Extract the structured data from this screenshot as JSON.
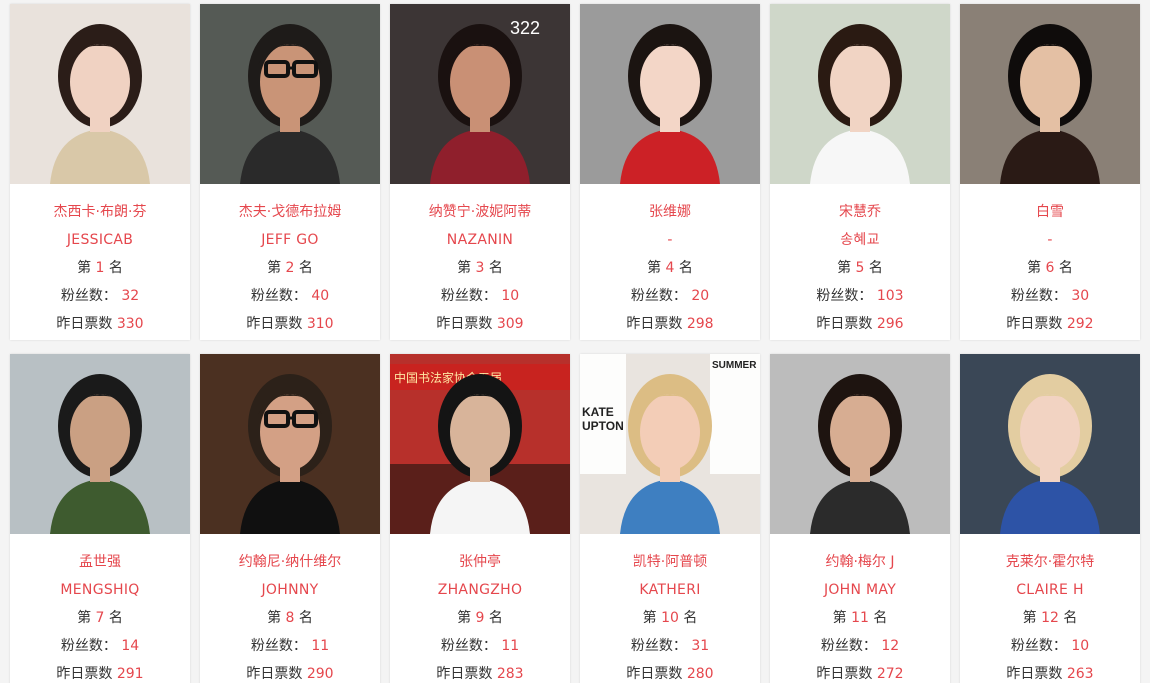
{
  "accent_color": "#e5474d",
  "labels": {
    "rank_prefix": "第",
    "rank_suffix": "名",
    "fans": "粉丝数：",
    "votes": "昨日票数"
  },
  "stars": [
    {
      "name_cn": "杰西卡·布朗·芬",
      "name_en": "JESSICAB",
      "rank": "1",
      "fans": "32",
      "votes": "330"
    },
    {
      "name_cn": "杰夫·戈德布拉姆",
      "name_en": "JEFF GO",
      "rank": "2",
      "fans": "40",
      "votes": "310"
    },
    {
      "name_cn": "纳赞宁·波妮阿蒂",
      "name_en": "NAZANIN",
      "rank": "3",
      "fans": "10",
      "votes": "309"
    },
    {
      "name_cn": "张维娜",
      "name_en": "-",
      "rank": "4",
      "fans": "20",
      "votes": "298"
    },
    {
      "name_cn": "宋慧乔",
      "name_en": "송혜교",
      "rank": "5",
      "fans": "103",
      "votes": "296"
    },
    {
      "name_cn": "白雪",
      "name_en": "-",
      "rank": "6",
      "fans": "30",
      "votes": "292"
    },
    {
      "name_cn": "孟世强",
      "name_en": "MENGSHIQ",
      "rank": "7",
      "fans": "14",
      "votes": "291"
    },
    {
      "name_cn": "约翰尼·纳什维尔",
      "name_en": "JOHNNY",
      "rank": "8",
      "fans": "11",
      "votes": "290"
    },
    {
      "name_cn": "张仲亭",
      "name_en": "ZHANGZHO",
      "rank": "9",
      "fans": "11",
      "votes": "283"
    },
    {
      "name_cn": "凯特·阿普顿",
      "name_en": "KATHERI",
      "rank": "10",
      "fans": "31",
      "votes": "280"
    },
    {
      "name_cn": "约翰·梅尔 J",
      "name_en": "JOHN MAY",
      "rank": "11",
      "fans": "12",
      "votes": "272"
    },
    {
      "name_cn": "克莱尔·霍尔特",
      "name_en": "CLAIRE H",
      "rank": "12",
      "fans": "10",
      "votes": "263"
    }
  ],
  "photo_texts": {
    "p3": "322",
    "p9": "中国书法家协会五届",
    "p10_mag1": "KATE",
    "p10_mag2": "UPTON",
    "p10_mag3": "SUMMER"
  }
}
